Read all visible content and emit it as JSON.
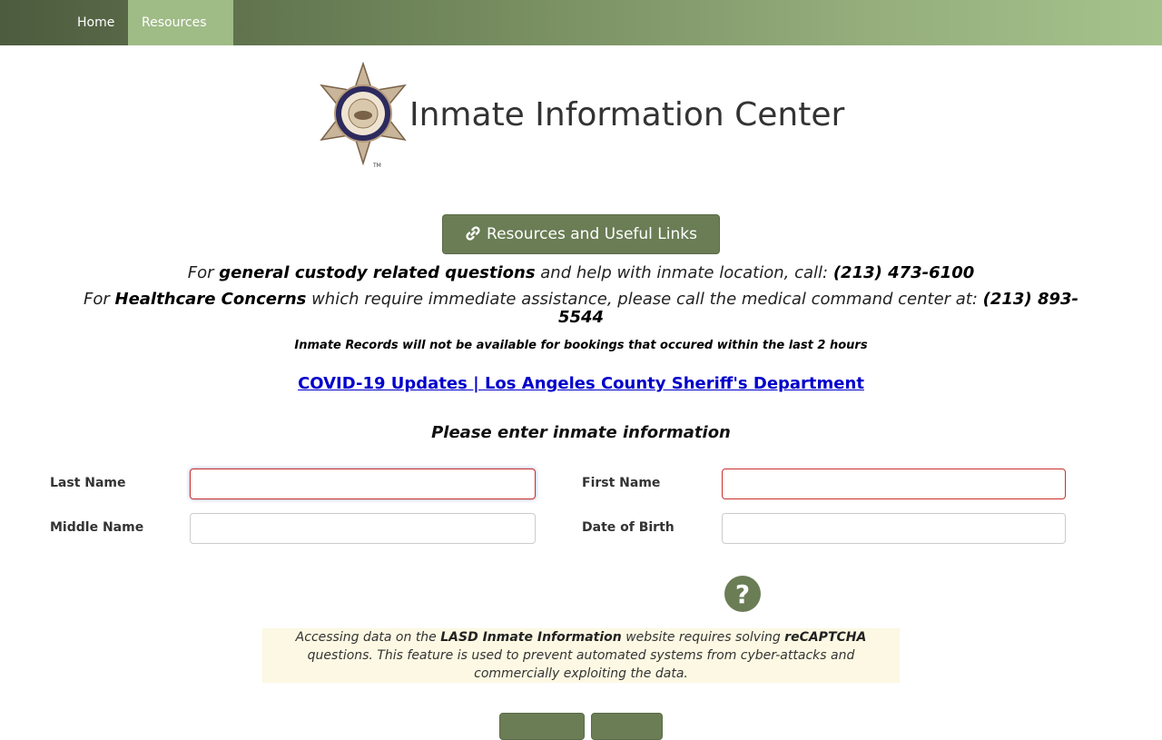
{
  "nav": {
    "home": "Home",
    "resources": "Resources"
  },
  "header": {
    "title": "Inmate Information Center",
    "badge_icon": "sheriff-star-badge"
  },
  "resources_button": {
    "label": "Resources and Useful Links",
    "icon": "link-icon"
  },
  "info": {
    "line1_pre": "For ",
    "line1_bold": "general custody related questions",
    "line1_mid": " and help with inmate location, call: ",
    "line1_phone": "(213) 473-6100",
    "line2_pre": "For ",
    "line2_bold": "Healthcare Concerns",
    "line2_mid": " which require immediate assistance, please call the medical command center at: ",
    "line2_phone": "(213) 893-5544",
    "notice": "Inmate Records will not be available for bookings that occured within the last 2 hours"
  },
  "covid_link": "COVID-19 Updates | Los Angeles County Sheriff's Department",
  "form": {
    "heading": "Please enter inmate information",
    "last_name_label": "Last Name",
    "last_name_value": "",
    "first_name_label": "First Name",
    "first_name_value": "",
    "middle_name_label": "Middle Name",
    "middle_name_value": "",
    "dob_label": "Date of Birth",
    "dob_value": ""
  },
  "recaptcha": {
    "pre": "Accessing data on the ",
    "bold1": "LASD Inmate Information",
    "mid": " website requires solving ",
    "bold2": "reCAPTCHA",
    "post": " questions. This feature is used to prevent automated systems from cyber-attacks and commercially exploiting the data."
  },
  "colors": {
    "accent": "#6a7d55",
    "nav_active": "#9fbb86",
    "link": "#0000cc",
    "notice_bg": "#fcf8e3",
    "invalid_border": "#c9302c"
  }
}
